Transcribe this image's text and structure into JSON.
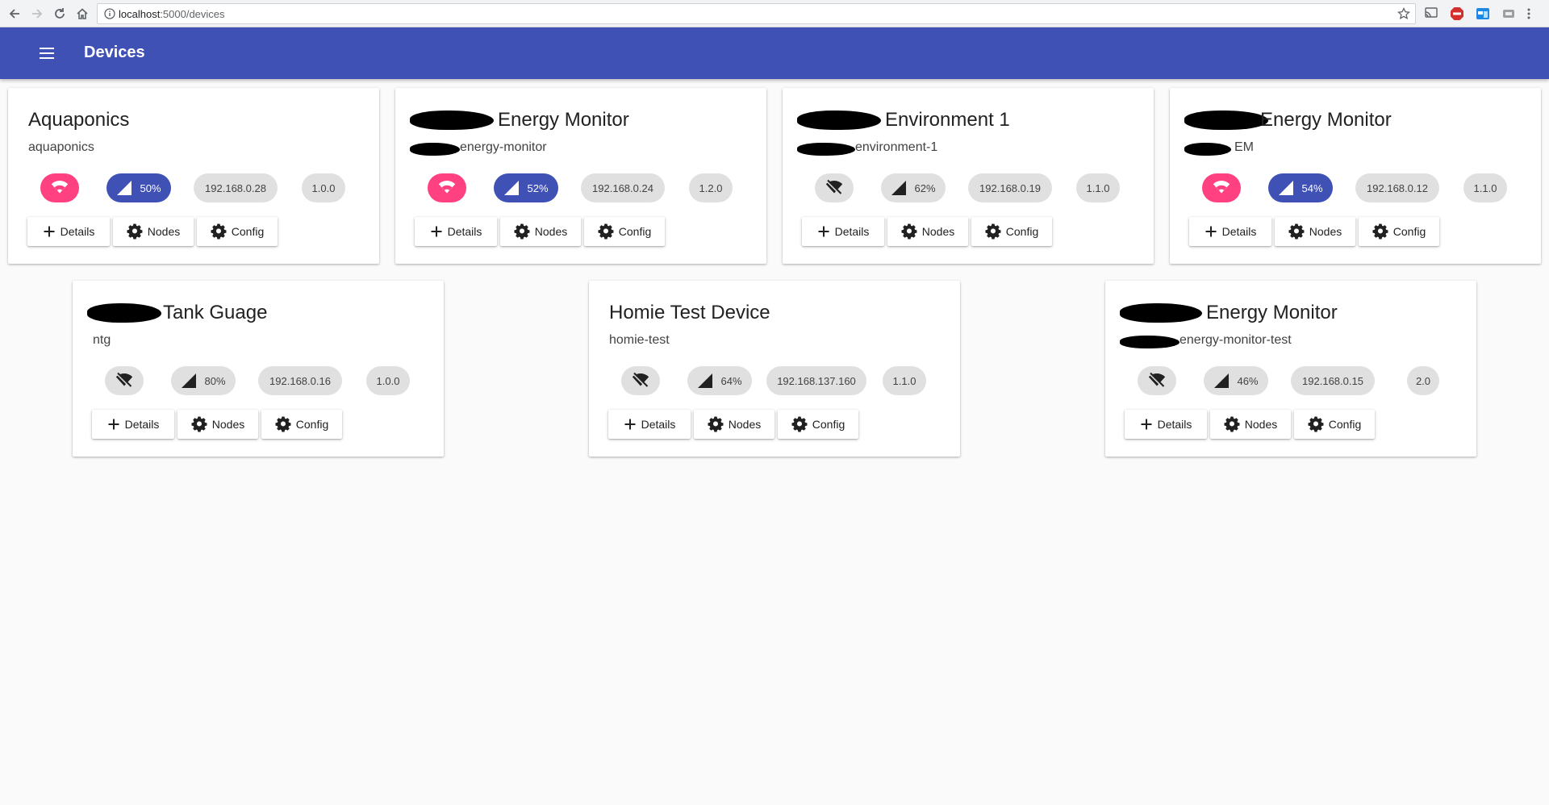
{
  "browser": {
    "url_host": "localhost",
    "url_rest": ":5000/devices"
  },
  "appbar": {
    "title": "Devices",
    "color": "#3f51b5"
  },
  "actions": {
    "details": "Details",
    "nodes": "Nodes",
    "config": "Config"
  },
  "colors": {
    "wifi_connected": "#ff4081",
    "signal_active": "#3f51b5",
    "chip_inactive": "#e0e0e0"
  },
  "devices": [
    {
      "title": "Aquaponics",
      "subtitle": "aquaponics",
      "online": true,
      "signal": "50%",
      "ip": "192.168.0.28",
      "version": "1.0.0"
    },
    {
      "title": "Energy Monitor",
      "subtitle": "energy-monitor",
      "online": true,
      "signal": "52%",
      "ip": "192.168.0.24",
      "version": "1.2.0"
    },
    {
      "title": "Environment 1",
      "subtitle": "environment-1",
      "online": false,
      "signal": "62%",
      "ip": "192.168.0.19",
      "version": "1.1.0"
    },
    {
      "title": "Energy Monitor",
      "subtitle": "EM",
      "online": true,
      "signal": "54%",
      "ip": "192.168.0.12",
      "version": "1.1.0"
    },
    {
      "title": "Tank Guage",
      "subtitle": "ntg",
      "online": false,
      "signal": "80%",
      "ip": "192.168.0.16",
      "version": "1.0.0"
    },
    {
      "title": "Homie Test Device",
      "subtitle": "homie-test",
      "online": false,
      "signal": "64%",
      "ip": "192.168.137.160",
      "version": "1.1.0"
    },
    {
      "title": "Energy Monitor",
      "subtitle": "energy-monitor-test",
      "online": false,
      "signal": "46%",
      "ip": "192.168.0.15",
      "version": "2.0"
    }
  ]
}
